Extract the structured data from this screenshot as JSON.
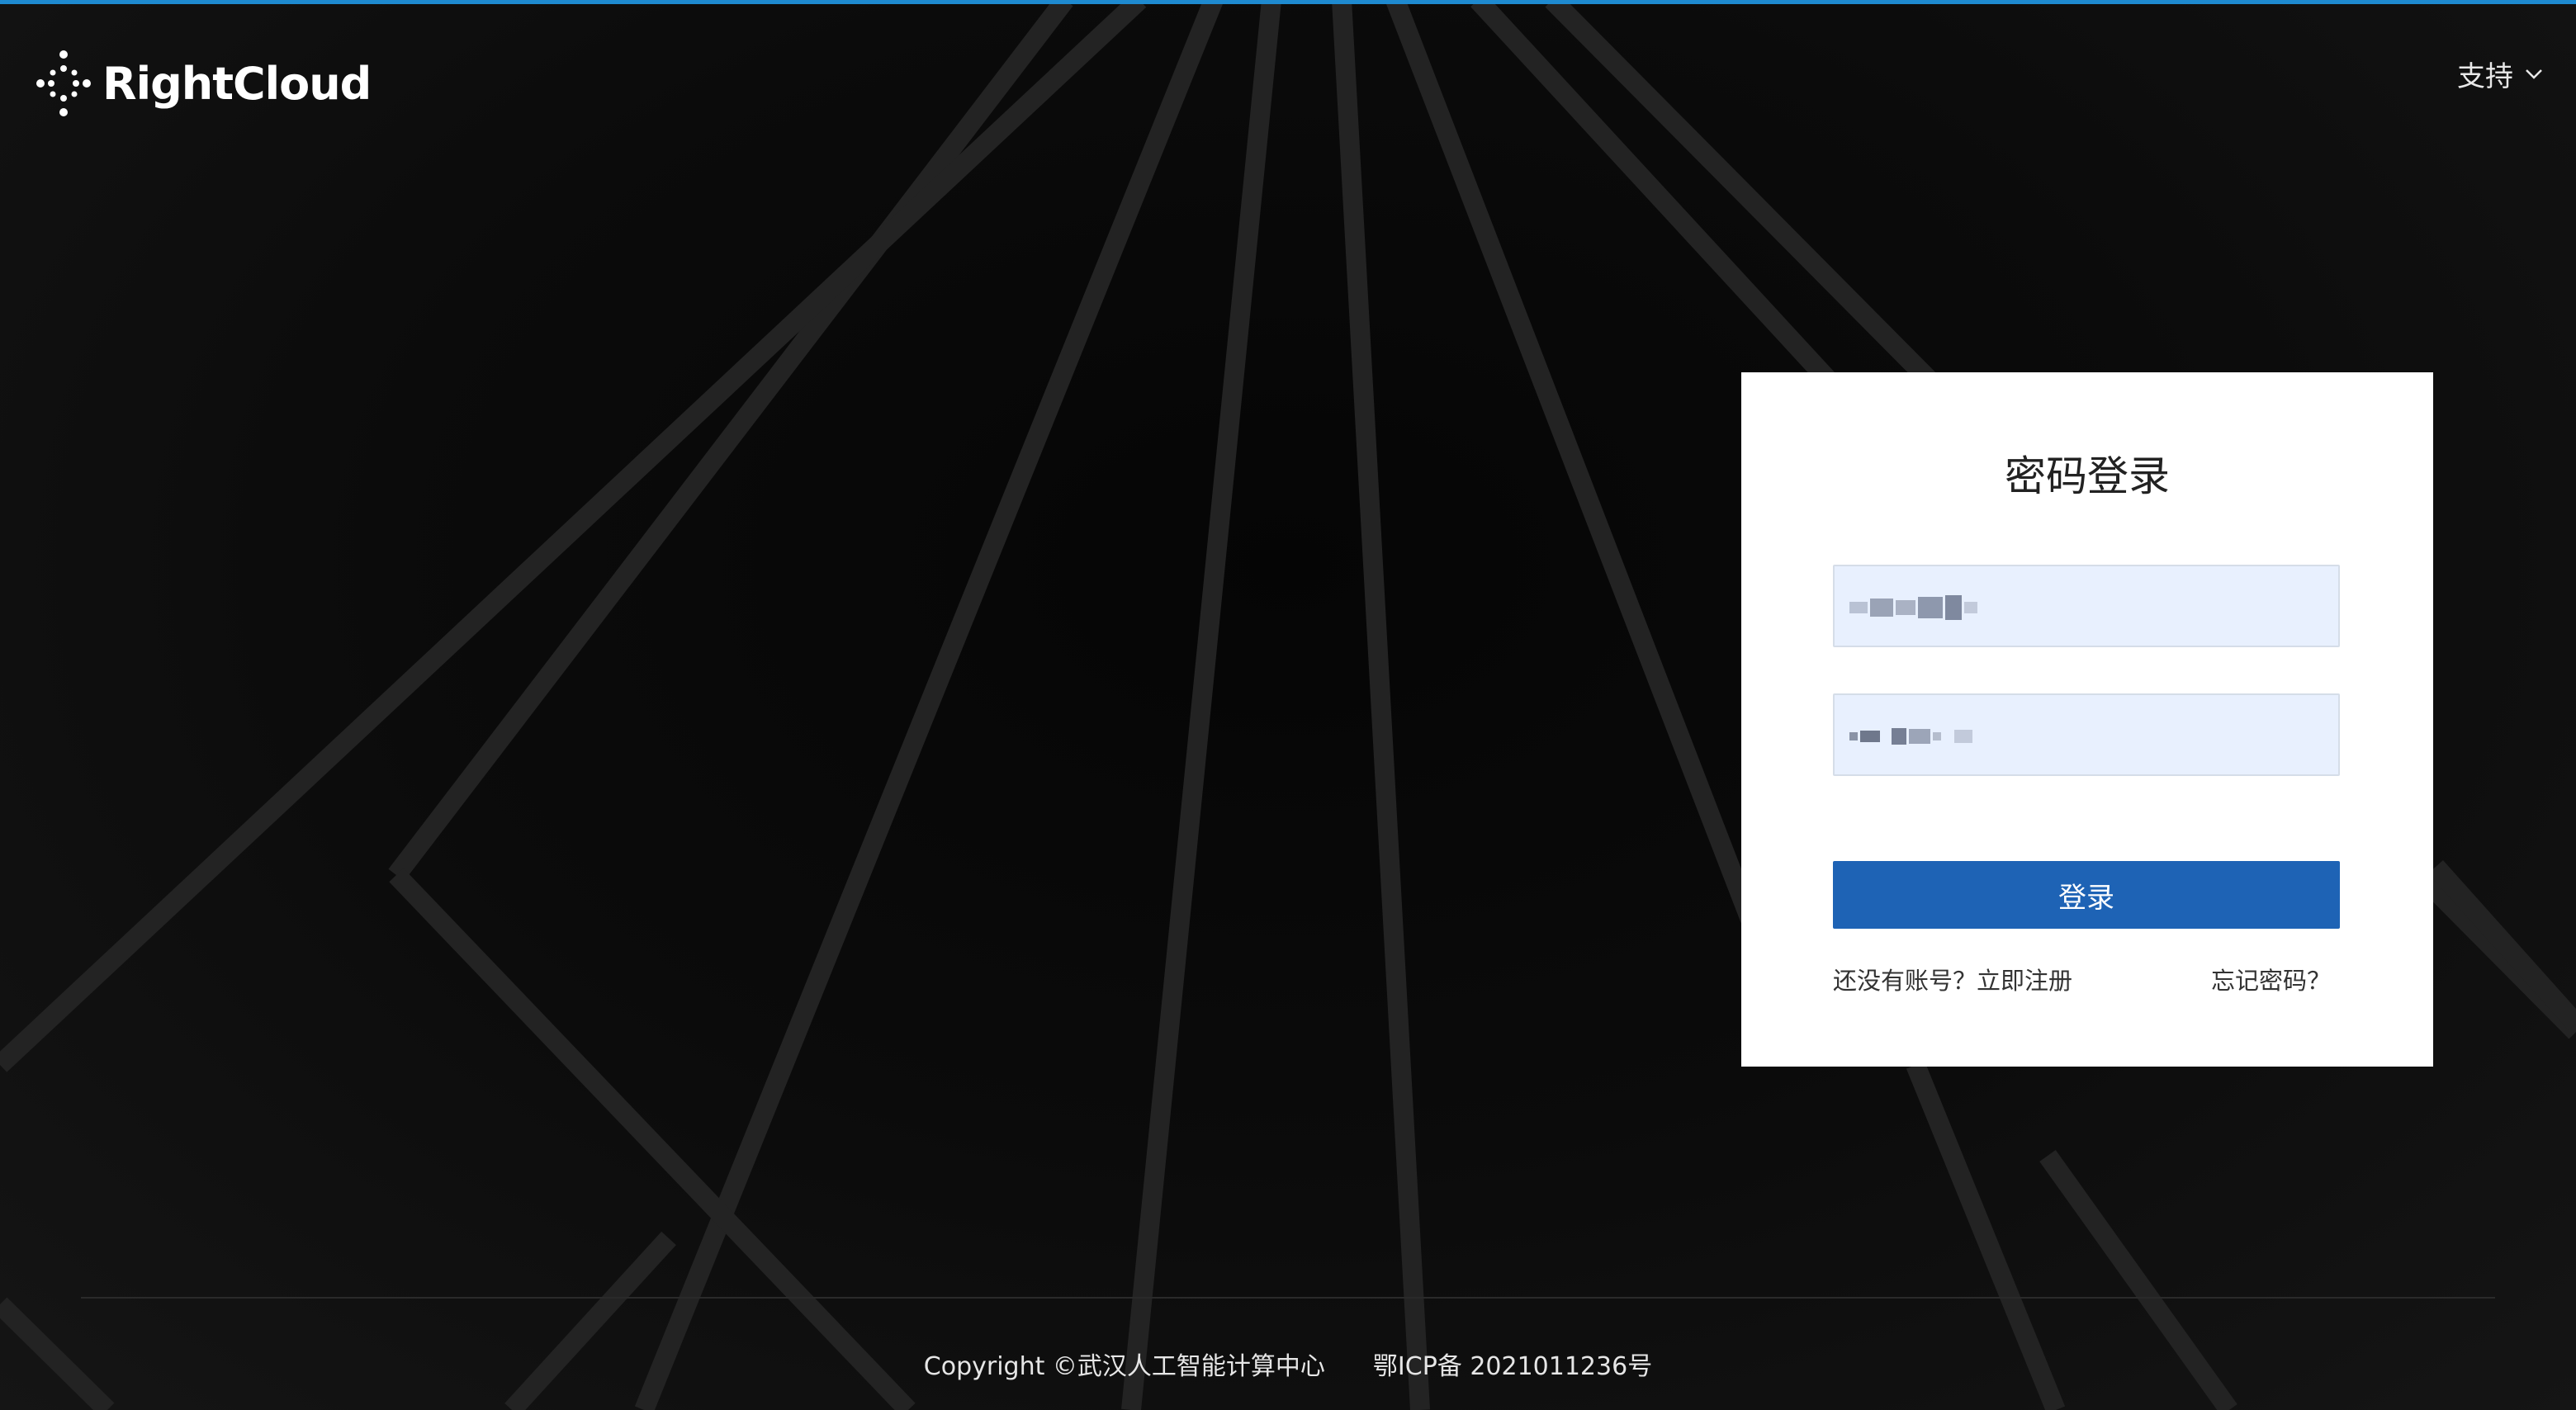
{
  "brand": {
    "name": "RightCloud"
  },
  "header": {
    "support_label": "支持"
  },
  "login": {
    "title": "密码登录",
    "username_value": "",
    "password_value": "",
    "submit_label": "登录",
    "register_link": "还没有账号？立即注册",
    "forgot_link": "忘记密码？"
  },
  "footer": {
    "copyright": "Copyright ©武汉人工智能计算中心",
    "icp": "鄂ICP备 2021011236号"
  },
  "colors": {
    "accent_top": "#1e8ad0",
    "button": "#1e63b5",
    "input_bg": "#e8f0fe",
    "background": "#0a0a0a"
  },
  "icons": {
    "logo": "dotted-cross-logo-icon",
    "support_dropdown": "chevron-down-icon"
  }
}
